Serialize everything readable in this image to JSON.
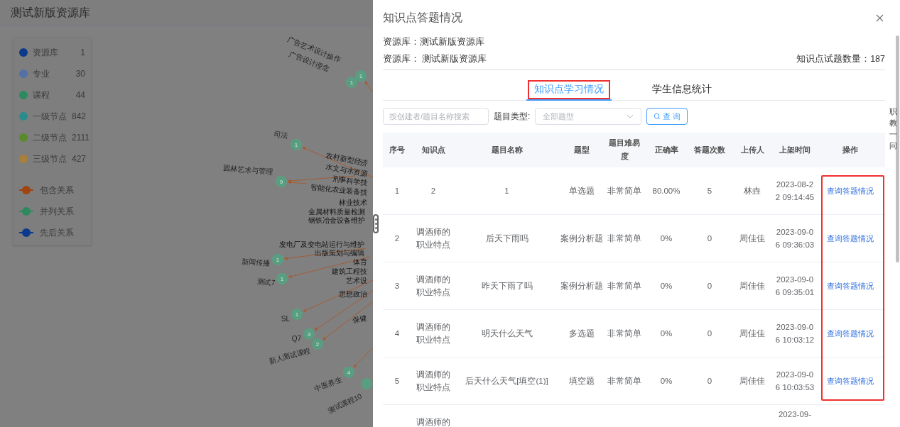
{
  "page": {
    "title": "测试新版资源库"
  },
  "legend": {
    "categories": [
      {
        "label": "资源库",
        "count": "1",
        "color": "#0b3a8c"
      },
      {
        "label": "专业",
        "count": "30",
        "color": "#5470a6"
      },
      {
        "label": "课程",
        "count": "44",
        "color": "#2d8a5e"
      },
      {
        "label": "一级节点",
        "count": "842",
        "color": "#2a8c8c"
      },
      {
        "label": "二级节点",
        "count": "2111",
        "color": "#5a8a2c"
      },
      {
        "label": "三级节点",
        "count": "427",
        "color": "#a8803c"
      }
    ],
    "relations": [
      {
        "label": "包含关系",
        "color": "#a04410"
      },
      {
        "label": "并列关系",
        "color": "#2d8a5e"
      },
      {
        "label": "先后关系",
        "color": "#0b3a8c"
      }
    ]
  },
  "graph": {
    "nodes": [
      {
        "count": "1",
        "label": "广告艺术设计操作"
      },
      {
        "count": "1",
        "label": "广告设计理念"
      },
      {
        "count": "1",
        "label": "司法"
      },
      {
        "count": "9",
        "label": "园林艺术与管理"
      },
      {
        "count": "1",
        "label": "新闻传播"
      },
      {
        "count": "1",
        "label": "测试7"
      },
      {
        "count": "1",
        "label": "SL"
      },
      {
        "count": "3",
        "label": "Q7"
      },
      {
        "count": "2",
        "label": "新人测试课程"
      },
      {
        "count": "4",
        "label": "中医养生"
      },
      {
        "label": "测试课程10"
      }
    ],
    "side_labels": [
      "农村新型经济",
      "水文与水资源",
      "刑事科学技",
      "智能化农业装备技",
      "林业技术",
      "金属材料质量检测",
      "钢铁冶金设备维护",
      "发电厂及变电站运行与维护",
      "出版策划与编辑",
      "体育",
      "建筑工程技",
      "艺术设",
      "思想政治",
      "保健"
    ]
  },
  "drawer": {
    "title": "知识点答题情况",
    "info": [
      "资源库：测试新版资源库",
      "资源库： 测试新版资源库"
    ],
    "question_count": "知识点试题数量：187",
    "tabs": [
      {
        "label": "知识点学习情况",
        "selected": true,
        "highlighted": true
      },
      {
        "label": "学生信息统计",
        "selected": false,
        "highlighted": false
      }
    ],
    "search": {
      "placeholder": "按创建者/题目名称搜索"
    },
    "type_filter": {
      "label": "题目类型:",
      "placeholder": "全部题型"
    },
    "query_button": "查 询",
    "table": {
      "columns": [
        "序号",
        "知识点",
        "题目名称",
        "题型",
        "题目难易度",
        "正确率",
        "答题次数",
        "上传人",
        "上架时间",
        "操作"
      ],
      "actions_highlighted": true,
      "last_row_cut": true,
      "rows": [
        [
          "1",
          "2",
          "1",
          "单选题",
          "非常简单",
          "80.00%",
          "5",
          "林垚",
          "2023-08-22 09:14:45",
          "查询答题情况"
        ],
        [
          "2",
          "调酒师的职业特点",
          "后天下雨吗",
          "案例分析题",
          "非常简单",
          "0%",
          "0",
          "周佳佳",
          "2023-09-06 09:36:03",
          "查询答题情况"
        ],
        [
          "3",
          "调酒师的职业特点",
          "昨天下雨了吗",
          "案例分析题",
          "非常简单",
          "0%",
          "0",
          "周佳佳",
          "2023-09-06 09:35:01",
          "查询答题情况"
        ],
        [
          "4",
          "调酒师的职业特点",
          "明天什么天气",
          "多选题",
          "非常简单",
          "0%",
          "0",
          "周佳佳",
          "2023-09-06 10:03:12",
          "查询答题情况"
        ],
        [
          "5",
          "调酒师的职业特点",
          "后天什么天气[填空(1)]",
          "填空题",
          "非常简单",
          "0%",
          "0",
          "周佳佳",
          "2023-09-06 10:03:53",
          "查询答题情况"
        ],
        [
          "",
          "调酒师的",
          "",
          "",
          "",
          "",
          "",
          "",
          "2023-09-",
          ""
        ]
      ]
    }
  },
  "side_widget": {
    "label": "职教一问"
  }
}
